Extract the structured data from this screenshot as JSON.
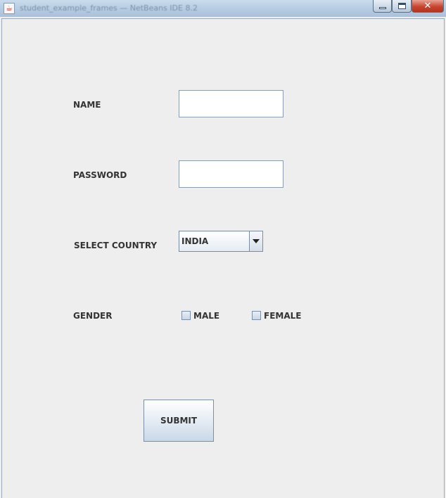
{
  "window": {
    "title": "student_example_frames — NetBeans IDE 8.2",
    "icon": "java-cup-icon",
    "controls": {
      "minimize": "minimize-icon",
      "maximize": "maximize-icon",
      "close": "close-icon"
    }
  },
  "form": {
    "name_label": "NAME",
    "name_value": "",
    "password_label": "PASSWORD",
    "password_value": "",
    "country_label": "SELECT COUNTRY",
    "country_selected": "INDIA",
    "gender_label": "GENDER",
    "gender_options": [
      {
        "label": "MALE",
        "checked": false
      },
      {
        "label": "FEMALE",
        "checked": false
      }
    ],
    "submit_label": "SUBMIT"
  }
}
